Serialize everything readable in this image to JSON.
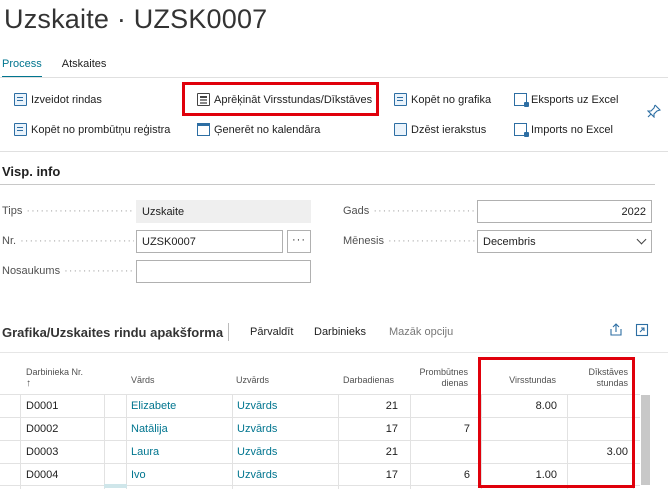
{
  "page": {
    "title": "Uzskaite · UZSK0007"
  },
  "tabs": [
    {
      "label": "Process",
      "active": true
    },
    {
      "label": "Atskaites",
      "active": false
    }
  ],
  "actions": {
    "izveidot_rindas": "Izveidot rindas",
    "kopet_no_prombutnu": "Kopēt no prombūtņu reģistra",
    "aprekinat": "Aprēķināt Virsstundas/Dīkstāves",
    "generet": "Ģenerēt no kalendāra",
    "kopet_no_grafika": "Kopēt no grafika",
    "dzest_ierakstus": "Dzēst ierakstus",
    "eksports": "Eksports uz Excel",
    "imports": "Imports no Excel"
  },
  "general": {
    "section_title": "Visp. info",
    "tips_label": "Tips",
    "tips_value": "Uzskaite",
    "nr_label": "Nr.",
    "nr_value": "UZSK0007",
    "nr_lookup": "···",
    "nosaukums_label": "Nosaukums",
    "nosaukums_value": "",
    "gads_label": "Gads",
    "gads_value": "2022",
    "menesis_label": "Mēnesis",
    "menesis_value": "Decembris"
  },
  "subform": {
    "title": "Grafika/Uzskaites rindu apakšforma",
    "parvaldit": "Pārvaldīt",
    "darbinieks": "Darbinieks",
    "mazak_opciju": "Mazāk opciju",
    "columns": {
      "darbinieka_nr": "Darbinieka Nr.",
      "sort_arrow": "↑",
      "vards": "Vārds",
      "uzvards": "Uzvārds",
      "darbadienas": "Darbadienas",
      "prombutnes_line1": "Prombūtnes",
      "prombutnes_line2": "dienas",
      "virsstundas": "Virsstundas",
      "dikstaves_line1": "Dīkstāves",
      "dikstaves_line2": "stundas"
    },
    "rows": [
      {
        "nr": "D0001",
        "vards": "Elizabete",
        "uzvards": "Uzvārds",
        "darbadienas": "21",
        "prombutnes": "",
        "virsstundas": "8.00",
        "dikstaves": ""
      },
      {
        "nr": "D0002",
        "vards": "Natālija",
        "uzvards": "Uzvārds",
        "darbadienas": "17",
        "prombutnes": "7",
        "virsstundas": "",
        "dikstaves": ""
      },
      {
        "nr": "D0003",
        "vards": "Laura",
        "uzvards": "Uzvārds",
        "darbadienas": "21",
        "prombutnes": "",
        "virsstundas": "",
        "dikstaves": "3.00"
      },
      {
        "nr": "D0004",
        "vards": "Ivo",
        "uzvards": "Uzvārds",
        "darbadienas": "17",
        "prombutnes": "6",
        "virsstundas": "1.00",
        "dikstaves": ""
      }
    ]
  },
  "colors": {
    "accent": "#00758f",
    "highlight": "#e0000b",
    "icon": "#2d6ea3"
  },
  "icons": [
    "doc-icon",
    "calculator-icon",
    "calendar-icon",
    "delete-icon",
    "excel-icon",
    "pin-icon",
    "share-icon",
    "expand-icon"
  ]
}
